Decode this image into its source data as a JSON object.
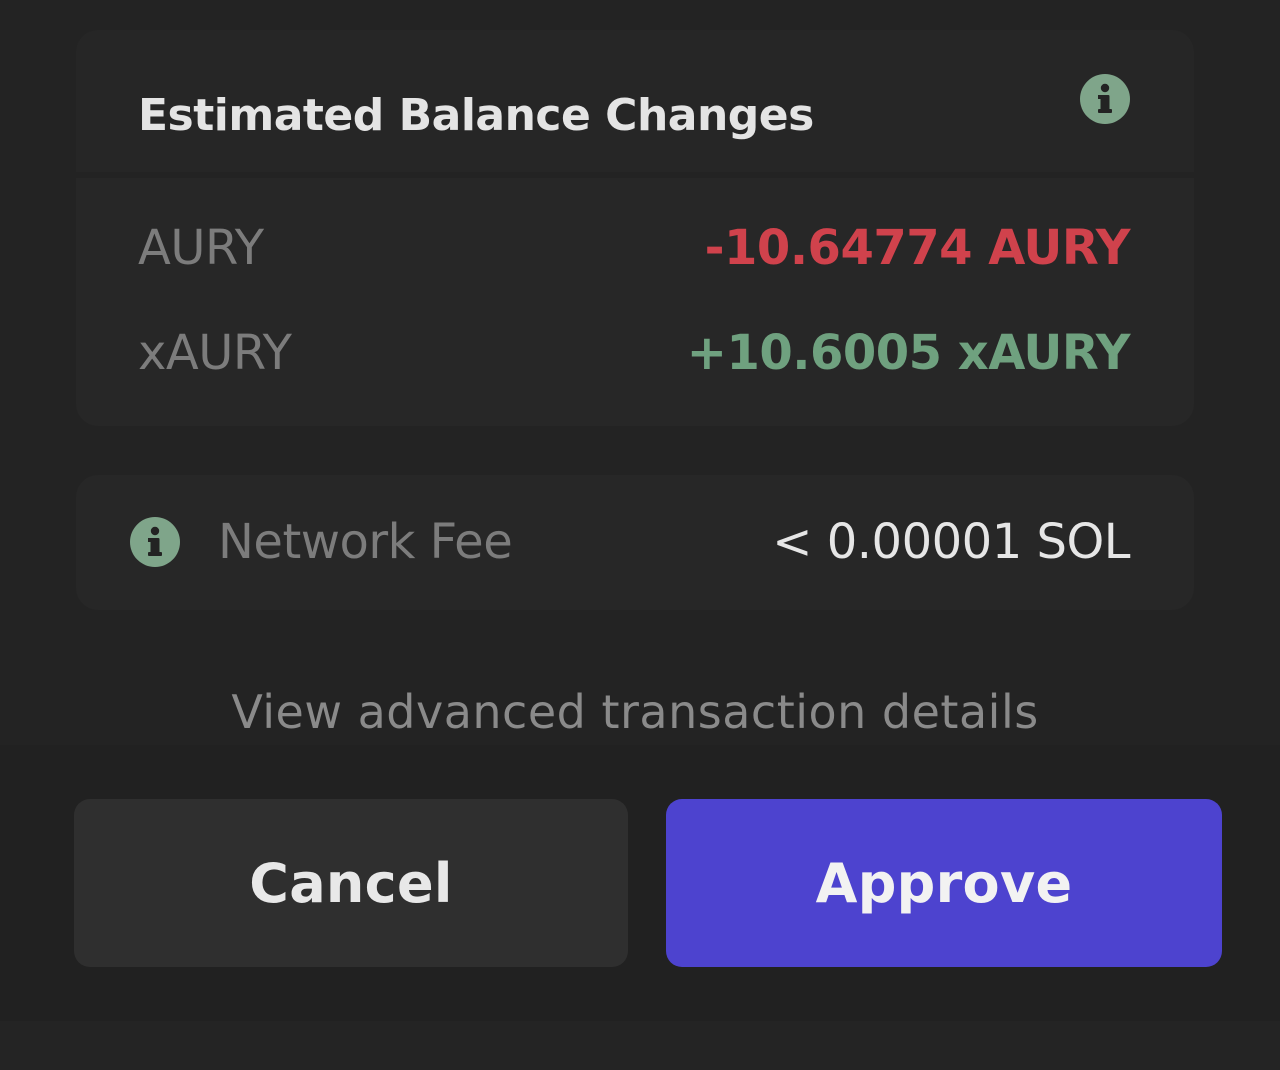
{
  "balance_changes": {
    "title": "Estimated Balance Changes",
    "info_icon": "info-icon",
    "rows": [
      {
        "token": "AURY",
        "change": "-10.64774 AURY",
        "direction": "negative",
        "color": "#d0424c"
      },
      {
        "token": "xAURY",
        "change": "+10.6005 xAURY",
        "direction": "positive",
        "color": "#6fa17f"
      }
    ]
  },
  "network_fee": {
    "icon": "info-icon",
    "label": "Network Fee",
    "value": "< 0.00001 SOL"
  },
  "advanced_link": "View advanced transaction details",
  "actions": {
    "cancel_label": "Cancel",
    "approve_label": "Approve",
    "approve_color": "#4d43cf"
  }
}
